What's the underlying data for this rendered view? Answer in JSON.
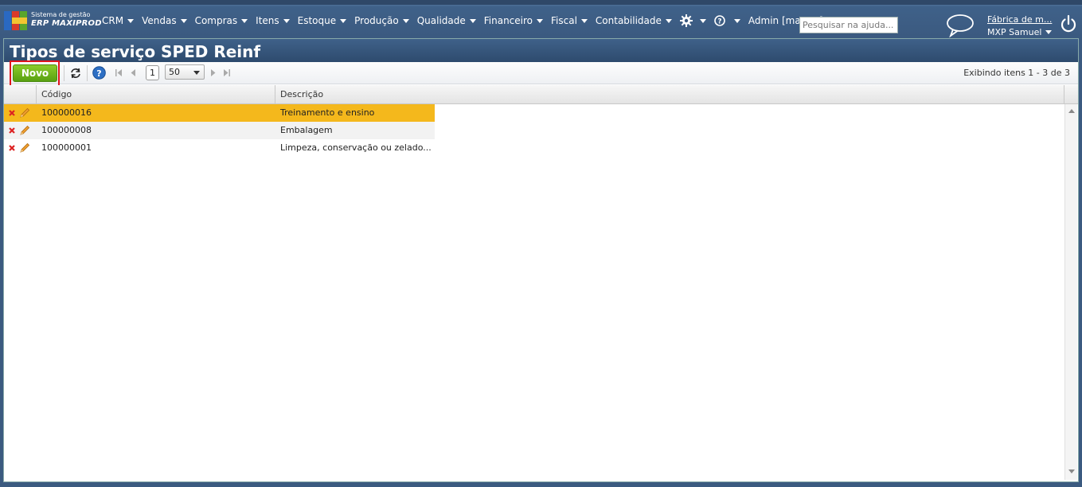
{
  "app": {
    "brand_line1": "Sistema de gestão",
    "brand_line2": "ERP MAXIPROD"
  },
  "nav": {
    "items": [
      {
        "label": "CRM"
      },
      {
        "label": "Vendas"
      },
      {
        "label": "Compras"
      },
      {
        "label": "Itens"
      },
      {
        "label": "Estoque"
      },
      {
        "label": "Produção"
      },
      {
        "label": "Qualidade"
      },
      {
        "label": "Financeiro"
      },
      {
        "label": "Fiscal"
      },
      {
        "label": "Contabilidade"
      }
    ],
    "user_menu": "Admin [master]",
    "search_placeholder": "Pesquisar na ajuda...",
    "company": "Fábrica de m...",
    "user": "MXP Samuel",
    "settings_icon": "gear-icon",
    "help_icon": "help-icon",
    "chat_icon": "chat-bubble-icon",
    "power_icon": "power-icon"
  },
  "page": {
    "title": "Tipos de serviço SPED Reinf"
  },
  "toolbar": {
    "new_label": "Novo",
    "current_page": "1",
    "page_size": "50",
    "status": "Exibindo itens 1 - 3 de 3"
  },
  "grid": {
    "columns": [
      "Código",
      "Descrição"
    ],
    "rows": [
      {
        "code": "100000016",
        "description": "Treinamento e ensino",
        "selected": true
      },
      {
        "code": "100000008",
        "description": "Embalagem",
        "selected": false
      },
      {
        "code": "100000001",
        "description": "Limpeza, conservação ou zelado...",
        "selected": false
      }
    ]
  },
  "colors": {
    "header_blue": "#3b5a80",
    "new_button_green": "#6cb31c",
    "selected_row": "#f4b81c",
    "highlight_red": "#e0141c"
  }
}
